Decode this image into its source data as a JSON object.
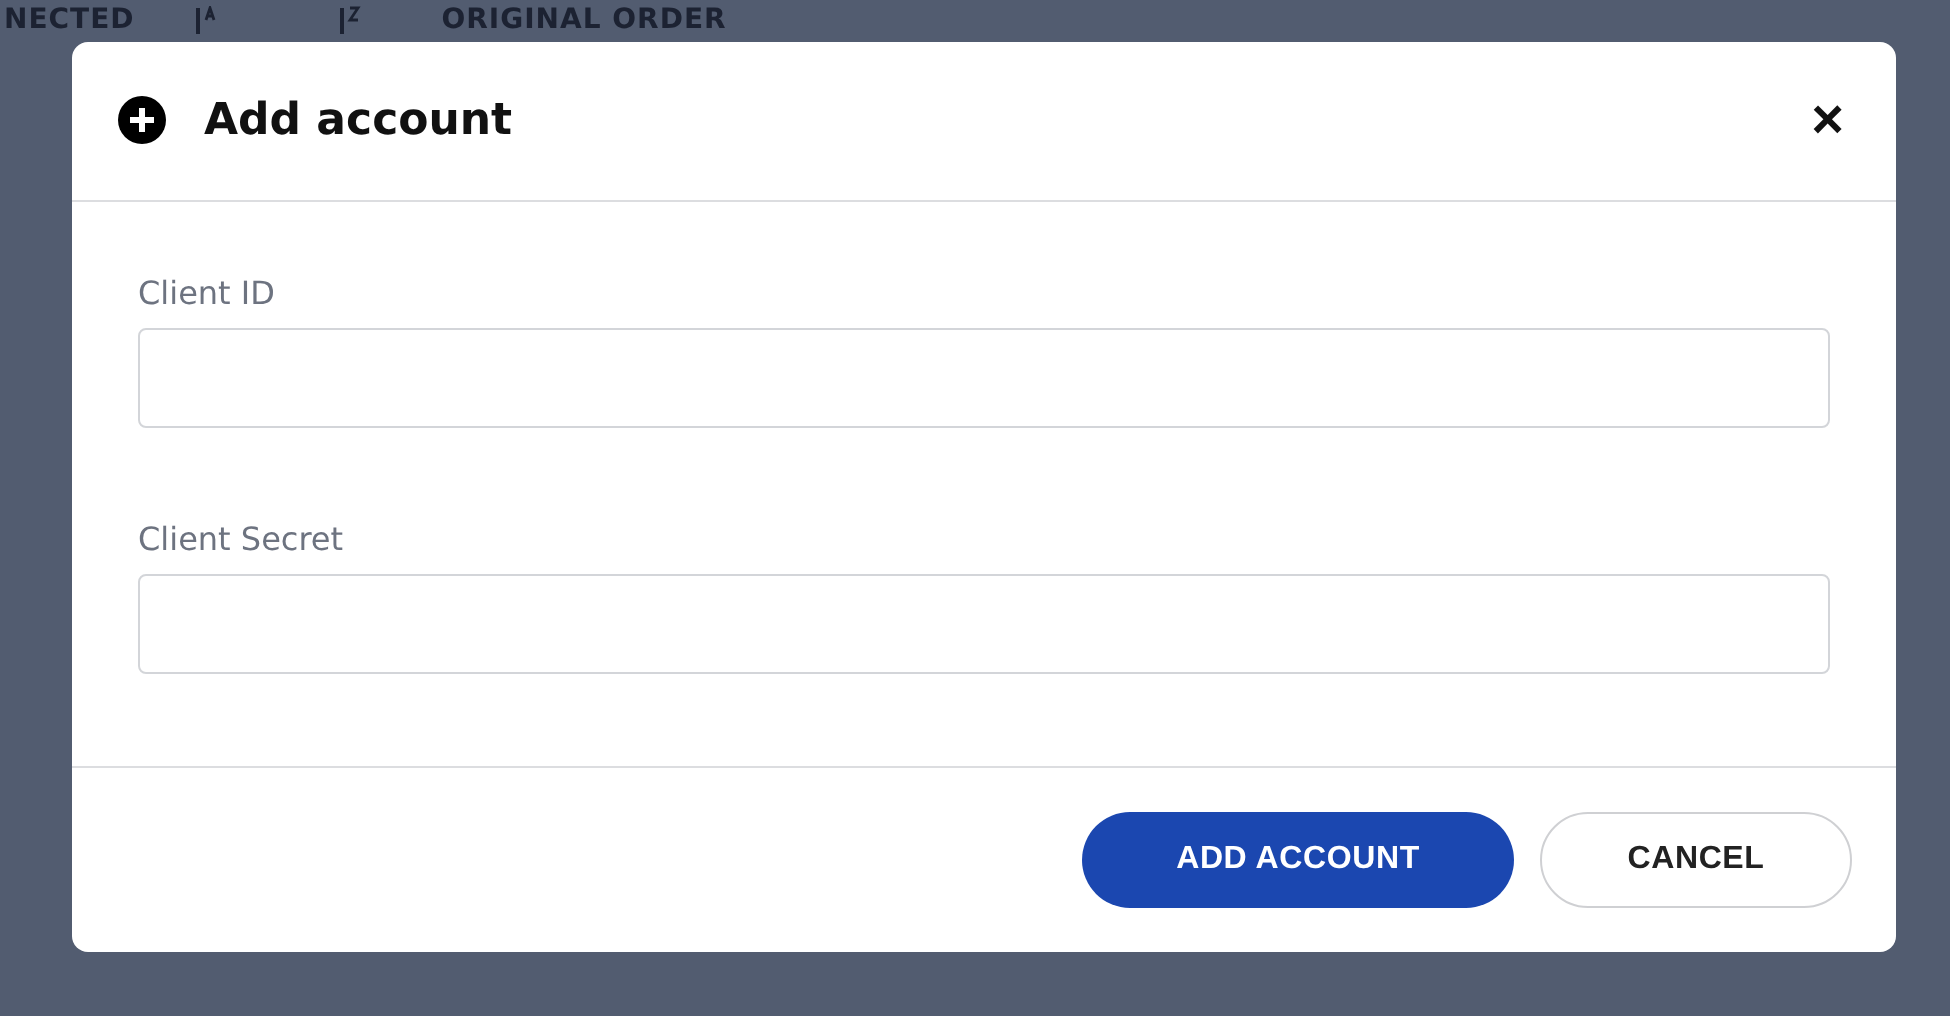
{
  "background_toolbar": {
    "items": [
      {
        "kind": "text",
        "label": "NECTED"
      },
      {
        "kind": "sort_az"
      },
      {
        "kind": "sort_za"
      },
      {
        "kind": "text",
        "label": "ORIGINAL ORDER"
      }
    ]
  },
  "dialog": {
    "title": "Add account",
    "close": "×",
    "fields": [
      {
        "label": "Client ID"
      },
      {
        "label": "Client Secret"
      }
    ],
    "buttons": [
      {
        "kind": "primary",
        "label": "ADD ACCOUNT"
      },
      {
        "kind": "secondary",
        "label": "CANCEL"
      }
    ]
  }
}
